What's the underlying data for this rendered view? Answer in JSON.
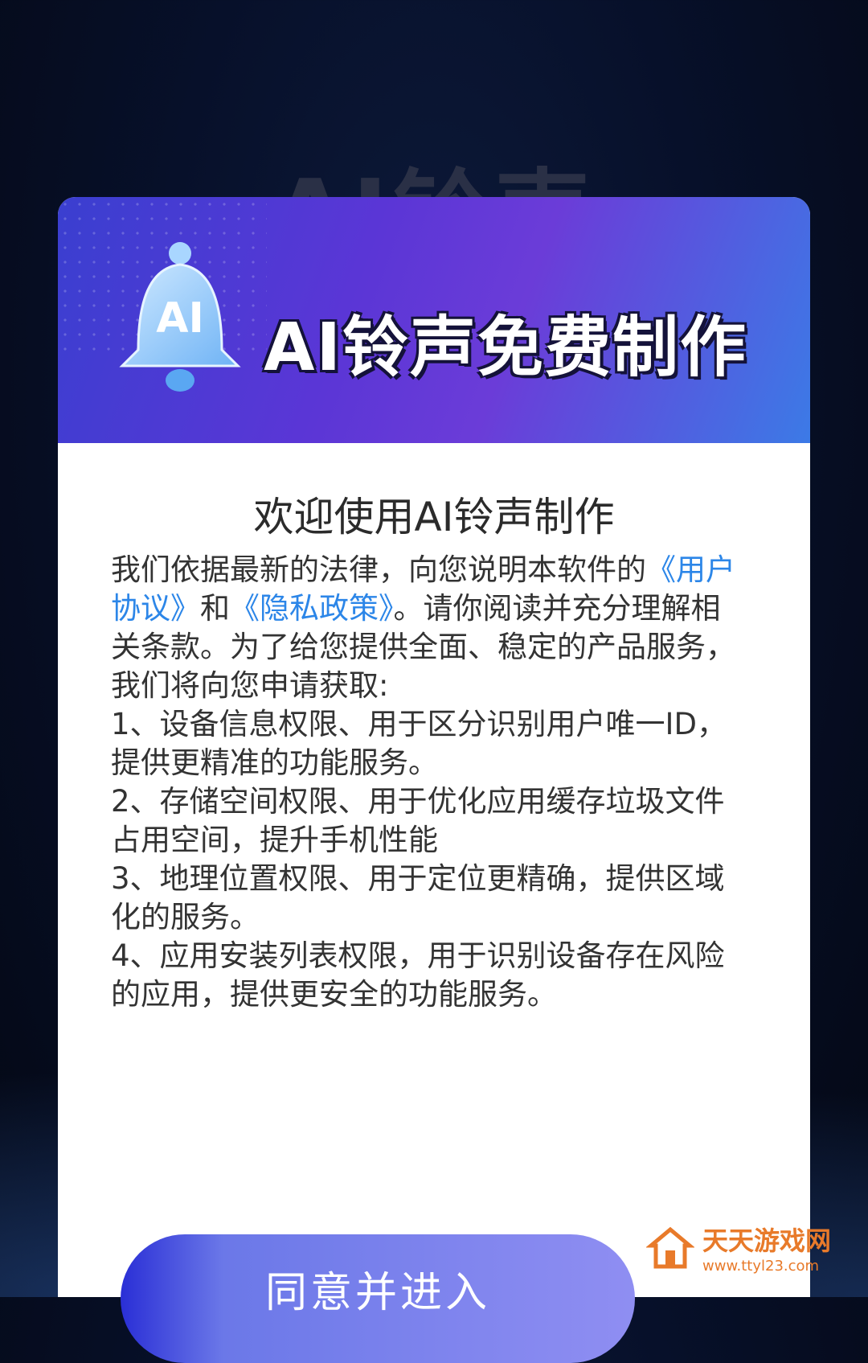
{
  "background": {
    "title": "AI铃声"
  },
  "banner": {
    "icon_text": "AI",
    "title": "AI铃声免费制作"
  },
  "dialog": {
    "heading": "欢迎使用AI铃声制作",
    "intro_before": "我们依据最新的法律，向您说明本软件的",
    "link_user_agreement": "《用户协议》",
    "intro_and": "和",
    "link_privacy": "《隐私政策》",
    "intro_after": "。请你阅读并充分理解相关条款。为了给您提供全面、稳定的产品服务，我们将向您申请获取:",
    "items": [
      "1、设备信息权限、用于区分识别用户唯一ID，提供更精准的功能服务。",
      "2、存储空间权限、用于优化应用缓存垃圾文件占用空间，提升手机性能",
      "3、地理位置权限、用于定位更精确，提供区域化的服务。",
      "4、应用安装列表权限，用于识别设备存在风险的应用，提供更安全的功能服务。"
    ],
    "agree_button": "同意并进入"
  },
  "watermark": {
    "name": "天天游戏网",
    "url": "www.ttyl23.com"
  },
  "colors": {
    "link": "#2c86e8",
    "banner_start": "#3a3fd0",
    "banner_end": "#3c7ae6",
    "watermark": "#e87a2a"
  }
}
